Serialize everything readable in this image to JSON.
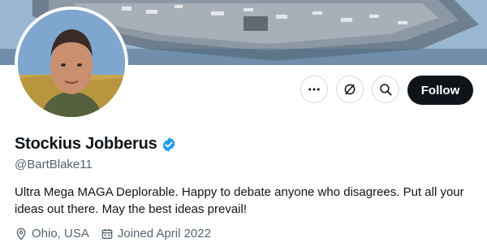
{
  "profile": {
    "display_name": "Stockius Jobberus",
    "handle": "@BartBlake11",
    "verified_icon": "verified-badge-icon",
    "bio": "Ultra Mega MAGA Deplorable. Happy to debate anyone who disagrees. Put all your ideas out there. May the best ideas prevail!",
    "location": "Ohio, USA",
    "joined": "Joined April 2022"
  },
  "actions": {
    "more_icon": "more-dots-icon",
    "subscribe_icon": "subscribe-icon",
    "search_icon": "search-icon",
    "follow_label": "Follow"
  },
  "colors": {
    "primary_text": "#0f1419",
    "secondary_text": "#536471",
    "verified_blue": "#1d9bf0",
    "follow_bg": "#0f1419",
    "border": "#cfd9de"
  }
}
